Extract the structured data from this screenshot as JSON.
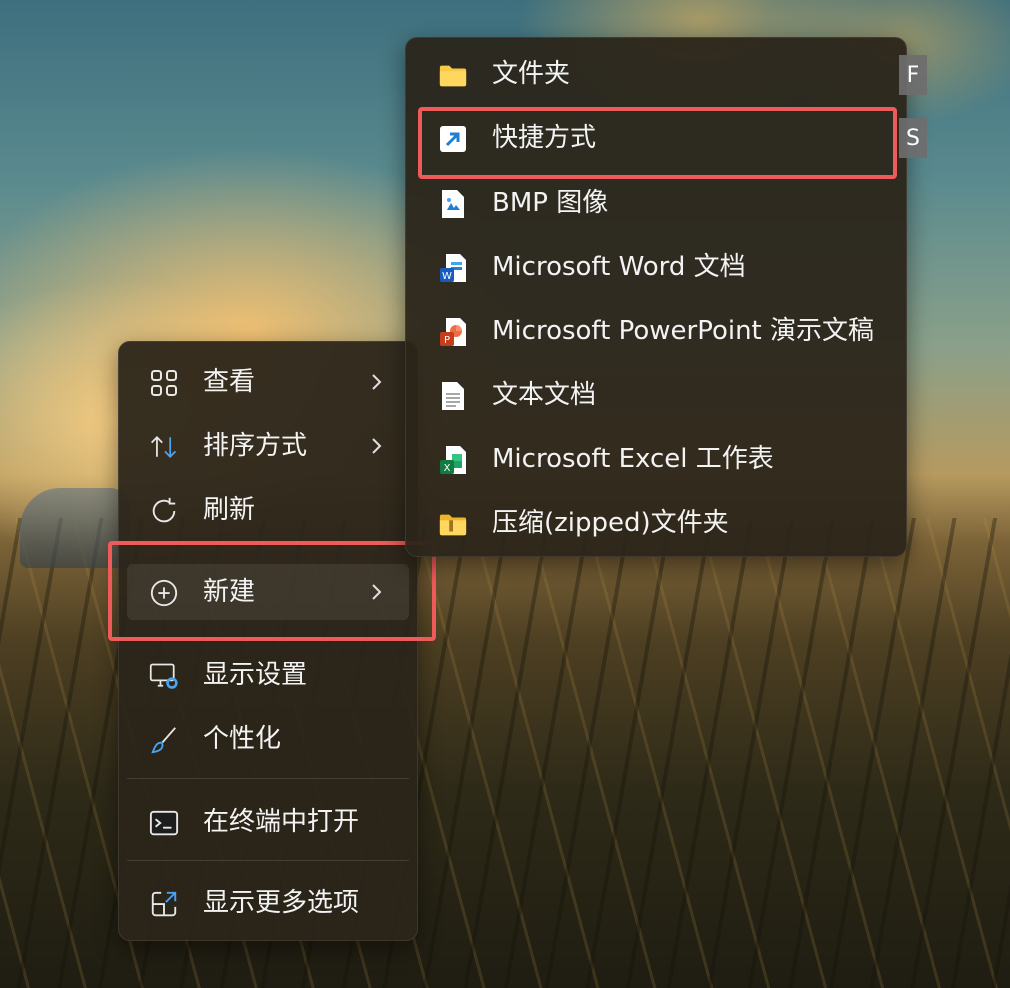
{
  "main_menu": {
    "items": [
      {
        "label": "查看",
        "icon": "grid-icon"
      },
      {
        "label": "排序方式",
        "icon": "sort-icon"
      },
      {
        "label": "刷新",
        "icon": "refresh-icon"
      },
      {
        "label": "新建",
        "icon": "add-circle-icon"
      },
      {
        "label": "显示设置",
        "icon": "display-settings-icon"
      },
      {
        "label": "个性化",
        "icon": "brush-icon"
      },
      {
        "label": "在终端中打开",
        "icon": "terminal-icon"
      },
      {
        "label": "显示更多选项",
        "icon": "more-options-icon"
      }
    ]
  },
  "sub_menu": {
    "items": [
      {
        "label": "文件夹",
        "icon": "folder-icon"
      },
      {
        "label": "快捷方式",
        "icon": "shortcut-icon"
      },
      {
        "label": "BMP 图像",
        "icon": "bmp-image-icon"
      },
      {
        "label": "Microsoft Word 文档",
        "icon": "word-icon"
      },
      {
        "label": "Microsoft PowerPoint 演示文稿",
        "icon": "powerpoint-icon"
      },
      {
        "label": "文本文档",
        "icon": "text-document-icon"
      },
      {
        "label": "Microsoft Excel 工作表",
        "icon": "excel-icon"
      },
      {
        "label": "压缩(zipped)文件夹",
        "icon": "zip-folder-icon"
      }
    ]
  },
  "access_keys": {
    "folder": "F",
    "shortcut": "S"
  },
  "colors": {
    "highlight_box": "#ef5a5a",
    "accent_blue": "#4aa3f0"
  }
}
